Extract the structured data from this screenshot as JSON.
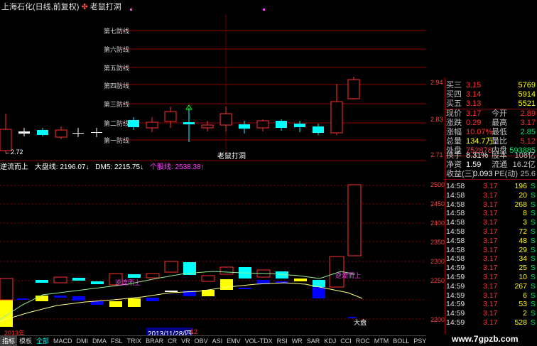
{
  "window": {
    "title": "上海石化(日线,前复权)",
    "indicator_name": "老鼠打洞"
  },
  "defense_lines": [
    "第七防线",
    "第六防线",
    "第五防线",
    "第四防线",
    "第三防线",
    "第二防线",
    "第一防线"
  ],
  "main_chart": {
    "marker_low": "←2.72",
    "pattern_label": "老鼠打洞",
    "axis_labels": [
      "2.94",
      "2.83",
      "2.71"
    ]
  },
  "indicator_bar": {
    "label1": "逆流而上",
    "label2": "大盘线: 2196.07↓",
    "label3": "DM5: 2215.75↓",
    "label4": "个股线: 2538.38↑"
  },
  "lower_chart": {
    "axis_labels": [
      "2500",
      "2450",
      "2400",
      "2350",
      "2300",
      "2250",
      "2200"
    ],
    "annotation1": "逆流而上",
    "annotation2": "逆流而上",
    "annotation3": "大盘",
    "year_label": "2013年",
    "date_label": "2013/11/28/四",
    "date_extra": "12"
  },
  "quote": {
    "asks": [
      {
        "label": "买三",
        "price": "3.15",
        "vol": "5769"
      },
      {
        "label": "买四",
        "price": "3.14",
        "vol": "5914"
      },
      {
        "label": "买五",
        "price": "3.13",
        "vol": "5521"
      }
    ],
    "stats": [
      {
        "l1": "现价",
        "v1": "3.17",
        "l2": "今开",
        "v2": "2.89",
        "c2": "#ff3030"
      },
      {
        "l1": "涨跌",
        "v1": "0.29",
        "l2": "最高",
        "v2": "3.17",
        "c2": "#ff3030"
      },
      {
        "l1": "涨幅",
        "v1": "10.07%",
        "l2": "最低",
        "v2": "2.85",
        "c2": "#00e070"
      },
      {
        "l1": "总量",
        "v1": "134.7万",
        "l2": "量比",
        "v2": "5.12",
        "c2": "#ff3030"
      },
      {
        "l1": "外盘",
        "v1": "752878",
        "l2": "内盘",
        "v2": "593885",
        "c2": "#00e070"
      },
      {
        "l1": "换手",
        "v1": "8.31%",
        "l2": "股本",
        "v2": "108亿",
        "c2": "#c0c0c0"
      },
      {
        "l1": "净资",
        "v1": "1.59",
        "l2": "流通",
        "v2": "16.2亿",
        "c2": "#c0c0c0"
      },
      {
        "l1": "收益(三)",
        "v1": "0.093",
        "l2": "PE(动)",
        "v2": "25.6",
        "c2": "#c0c0c0"
      }
    ],
    "ticks": [
      {
        "t": "14:58",
        "p": "3.17",
        "v": "196",
        "s": "S"
      },
      {
        "t": "14:58",
        "p": "3.17",
        "v": "20",
        "s": "S"
      },
      {
        "t": "14:58",
        "p": "3.17",
        "v": "268",
        "s": "S"
      },
      {
        "t": "14:58",
        "p": "3.17",
        "v": "8",
        "s": "S"
      },
      {
        "t": "14:58",
        "p": "3.17",
        "v": "3",
        "s": "S"
      },
      {
        "t": "14:58",
        "p": "3.17",
        "v": "72",
        "s": "S"
      },
      {
        "t": "14:58",
        "p": "3.17",
        "v": "48",
        "s": "S"
      },
      {
        "t": "14:58",
        "p": "3.17",
        "v": "29",
        "s": "S"
      },
      {
        "t": "14:58",
        "p": "3.17",
        "v": "34",
        "s": "S"
      },
      {
        "t": "14:59",
        "p": "3.17",
        "v": "25",
        "s": "S"
      },
      {
        "t": "14:59",
        "p": "3.17",
        "v": "10",
        "s": "S"
      },
      {
        "t": "14:59",
        "p": "3.17",
        "v": "267",
        "s": "S"
      },
      {
        "t": "14:59",
        "p": "3.17",
        "v": "6",
        "s": "S"
      },
      {
        "t": "14:59",
        "p": "3.17",
        "v": "53",
        "s": "S"
      },
      {
        "t": "14:59",
        "p": "3.17",
        "v": "2",
        "s": "S"
      },
      {
        "t": "14:59",
        "p": "3.17",
        "v": "528",
        "s": "S"
      }
    ]
  },
  "tabs": [
    "指标",
    "模板",
    "全部",
    "MACD",
    "DMI",
    "DMA",
    "FSL",
    "TRIX",
    "BRAR",
    "CR",
    "VR",
    "OBV",
    "ASI",
    "EMV",
    "VOL-TDX",
    "RSI",
    "WR",
    "SAR",
    "KDJ",
    "CCI",
    "ROC",
    "MTM",
    "BOLL",
    "PSY",
    "MCST"
  ],
  "active_tab": "全部",
  "watermark": "www.7gpzb.com",
  "colors": {
    "up": "#ff3030",
    "down": "#00ffff",
    "yellow": "#ffff00",
    "blue": "#0000ff",
    "magenta": "#ff40ff"
  }
}
